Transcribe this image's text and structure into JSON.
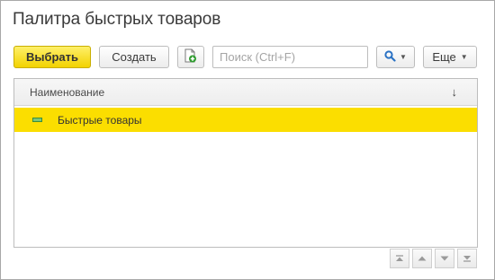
{
  "window": {
    "title": "Палитра быстрых товаров"
  },
  "toolbar": {
    "select_label": "Выбрать",
    "create_label": "Создать",
    "search": {
      "placeholder": "Поиск (Ctrl+F)",
      "value": "",
      "clear_symbol": "×"
    },
    "more_label": "Еще"
  },
  "table": {
    "columns": [
      {
        "label": "Наименование",
        "sort_symbol": "↓"
      }
    ],
    "rows": [
      {
        "label": "Быстрые товары",
        "selected": true
      }
    ]
  },
  "icons": {
    "copy": "document-with-green-plus-icon",
    "search": "magnifier-icon",
    "row_item": "green-bar-icon",
    "pager": [
      "first-page-icon",
      "previous-page-icon",
      "next-page-icon",
      "last-page-icon"
    ]
  },
  "colors": {
    "accent_yellow": "#fbde00",
    "primary_button": "#f2d200",
    "search_icon_blue": "#2a72c4",
    "item_green": "#79c779"
  }
}
